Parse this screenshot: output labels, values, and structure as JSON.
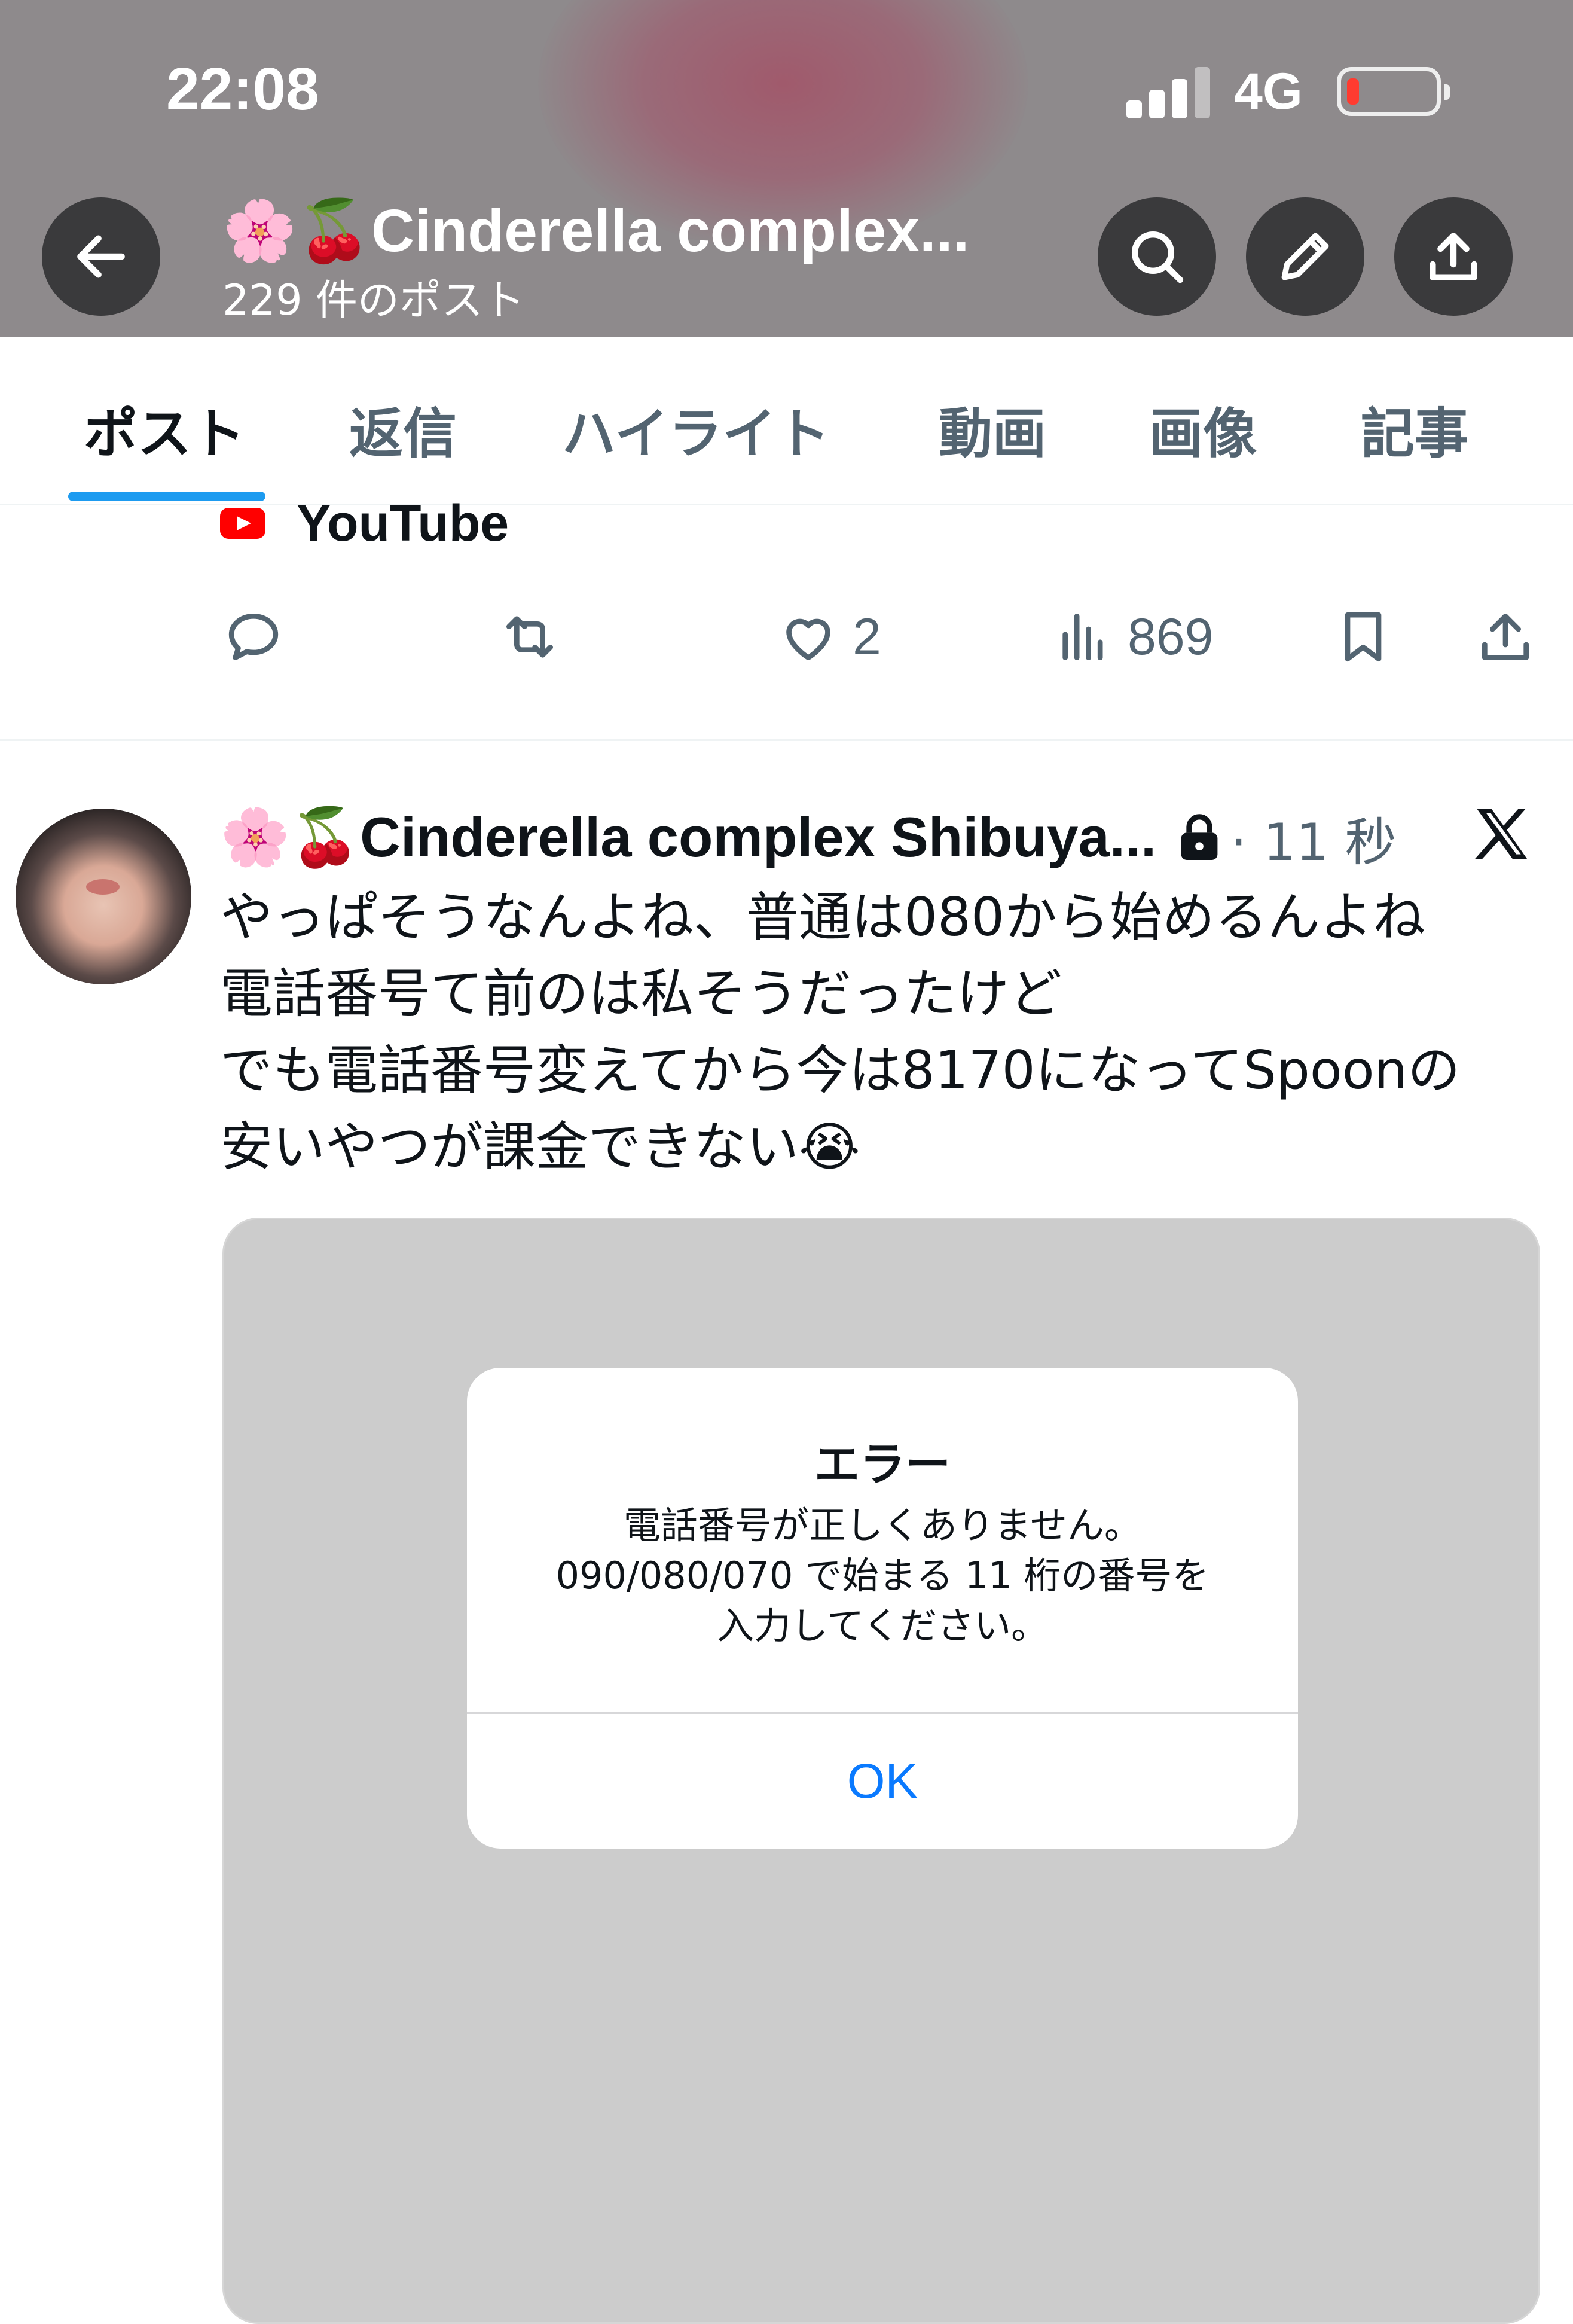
{
  "status_bar": {
    "time": "22:08",
    "network": "4G"
  },
  "profile_header": {
    "title_emoji": "🌸🍒",
    "title": "Cinderella complex...",
    "post_count": "229 件のポスト"
  },
  "tabs": [
    {
      "label": "ポスト",
      "active": true
    },
    {
      "label": "返信"
    },
    {
      "label": "ハイライト"
    },
    {
      "label": "動画"
    },
    {
      "label": "画像"
    },
    {
      "label": "記事"
    }
  ],
  "previous_post": {
    "link_label": "YouTube",
    "likes": "2",
    "views": "869"
  },
  "post": {
    "author_emoji": "🌸🍒",
    "author_name": "Cinderella complex Shibuya...",
    "time": "· 11 秒",
    "text": "やっぱそうなんよね、普通は080から始めるんよね\n電話番号て前のは私そうだったけど\nでも電話番号変えてから今は8170になってSpoonの\n安いやつが課金できない😭",
    "alert": {
      "title": "エラー",
      "message": "電話番号が正しくありません。\n090/080/070 で始まる 11 桁の番号を\n入力してください。",
      "ok_label": "OK"
    }
  },
  "colors": {
    "accent": "#1d9bf0",
    "text": "#0f1419",
    "secondary": "#536471",
    "ios_blue": "#0a7aff"
  }
}
